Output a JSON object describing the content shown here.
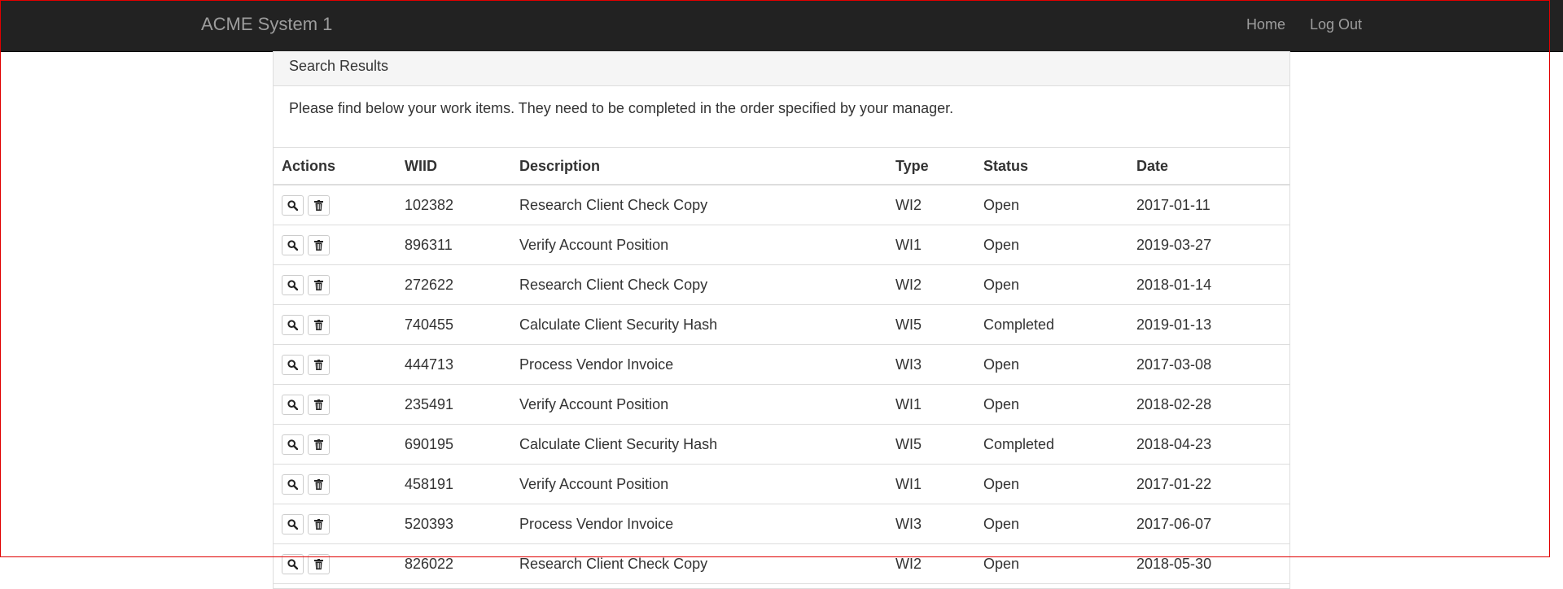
{
  "navbar": {
    "brand": "ACME System 1",
    "links": [
      "Home",
      "Log Out"
    ]
  },
  "panel": {
    "heading": "Search Results",
    "message": "Please find below your work items. They need to be completed in the order specified by your manager."
  },
  "table": {
    "headers": [
      "Actions",
      "WIID",
      "Description",
      "Type",
      "Status",
      "Date"
    ],
    "rows": [
      {
        "wiid": "102382",
        "description": "Research Client Check Copy",
        "type": "WI2",
        "status": "Open",
        "date": "2017-01-11"
      },
      {
        "wiid": "896311",
        "description": "Verify Account Position",
        "type": "WI1",
        "status": "Open",
        "date": "2019-03-27"
      },
      {
        "wiid": "272622",
        "description": "Research Client Check Copy",
        "type": "WI2",
        "status": "Open",
        "date": "2018-01-14"
      },
      {
        "wiid": "740455",
        "description": "Calculate Client Security Hash",
        "type": "WI5",
        "status": "Completed",
        "date": "2019-01-13"
      },
      {
        "wiid": "444713",
        "description": "Process Vendor Invoice",
        "type": "WI3",
        "status": "Open",
        "date": "2017-03-08"
      },
      {
        "wiid": "235491",
        "description": "Verify Account Position",
        "type": "WI1",
        "status": "Open",
        "date": "2018-02-28"
      },
      {
        "wiid": "690195",
        "description": "Calculate Client Security Hash",
        "type": "WI5",
        "status": "Completed",
        "date": "2018-04-23"
      },
      {
        "wiid": "458191",
        "description": "Verify Account Position",
        "type": "WI1",
        "status": "Open",
        "date": "2017-01-22"
      },
      {
        "wiid": "520393",
        "description": "Process Vendor Invoice",
        "type": "WI3",
        "status": "Open",
        "date": "2017-06-07"
      },
      {
        "wiid": "826022",
        "description": "Research Client Check Copy",
        "type": "WI2",
        "status": "Open",
        "date": "2018-05-30"
      }
    ]
  },
  "icons": {
    "view": "search-icon",
    "delete": "trash-icon"
  }
}
